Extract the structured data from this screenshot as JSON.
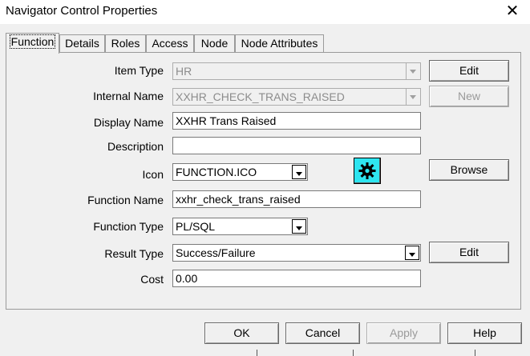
{
  "window": {
    "title": "Navigator Control Properties",
    "close_glyph": "✕"
  },
  "tabs": [
    {
      "label": "Function",
      "active": true
    },
    {
      "label": "Details"
    },
    {
      "label": "Roles"
    },
    {
      "label": "Access"
    },
    {
      "label": "Node"
    },
    {
      "label": "Node Attributes"
    }
  ],
  "form": {
    "item_type": {
      "label": "Item Type",
      "value": "HR",
      "enabled": false
    },
    "internal_name": {
      "label": "Internal Name",
      "value": "XXHR_CHECK_TRANS_RAISED",
      "enabled": false
    },
    "display_name": {
      "label": "Display Name",
      "value": "XXHR Trans Raised"
    },
    "description": {
      "label": "Description",
      "value": ""
    },
    "icon": {
      "label": "Icon",
      "value": "FUNCTION.ICO",
      "preview_icon": "gear-icon",
      "preview_color": "#2ee5f0"
    },
    "function_name": {
      "label": "Function Name",
      "value": "xxhr_check_trans_raised"
    },
    "function_type": {
      "label": "Function Type",
      "value": "PL/SQL"
    },
    "result_type": {
      "label": "Result Type",
      "value": "Success/Failure"
    },
    "cost": {
      "label": "Cost",
      "value": "0.00"
    }
  },
  "side_buttons": {
    "edit_item_type": "Edit",
    "new_internal_name": "New",
    "browse_icon": "Browse",
    "edit_result_type": "Edit"
  },
  "footer_buttons": {
    "ok": "OK",
    "cancel": "Cancel",
    "apply": "Apply",
    "help": "Help"
  }
}
